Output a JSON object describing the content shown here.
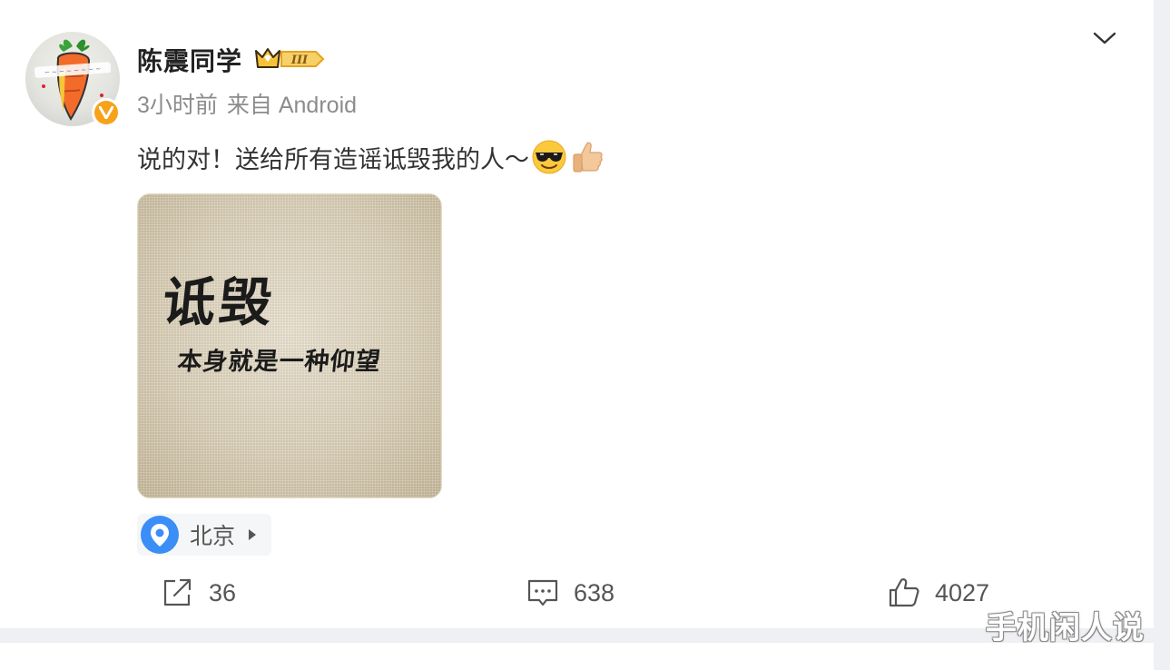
{
  "post": {
    "author": {
      "name": "陈震同学",
      "avatar_icon": "carrot-avatar",
      "verified_icon": "verified-v-icon",
      "vip_level_badge": "III"
    },
    "meta": {
      "time": "3小时前",
      "source": "来自 Android"
    },
    "text": "说的对！送给所有造谣诋毁我的人～",
    "text_emojis": [
      "cool-sunglasses-emoji",
      "thumbs-up-emoji"
    ],
    "image": {
      "headline": "诋毁",
      "subline": "本身就是一种仰望"
    },
    "location": {
      "label": "北京",
      "icon": "location-pin-icon"
    },
    "actions": {
      "repost_count": "36",
      "comment_count": "638",
      "like_count": "4027"
    }
  },
  "watermark": "手机闲人说",
  "colors": {
    "accent_blue": "#3a8ef6",
    "verified_orange": "#f7a21b",
    "meta_gray": "#8c8c8c"
  }
}
